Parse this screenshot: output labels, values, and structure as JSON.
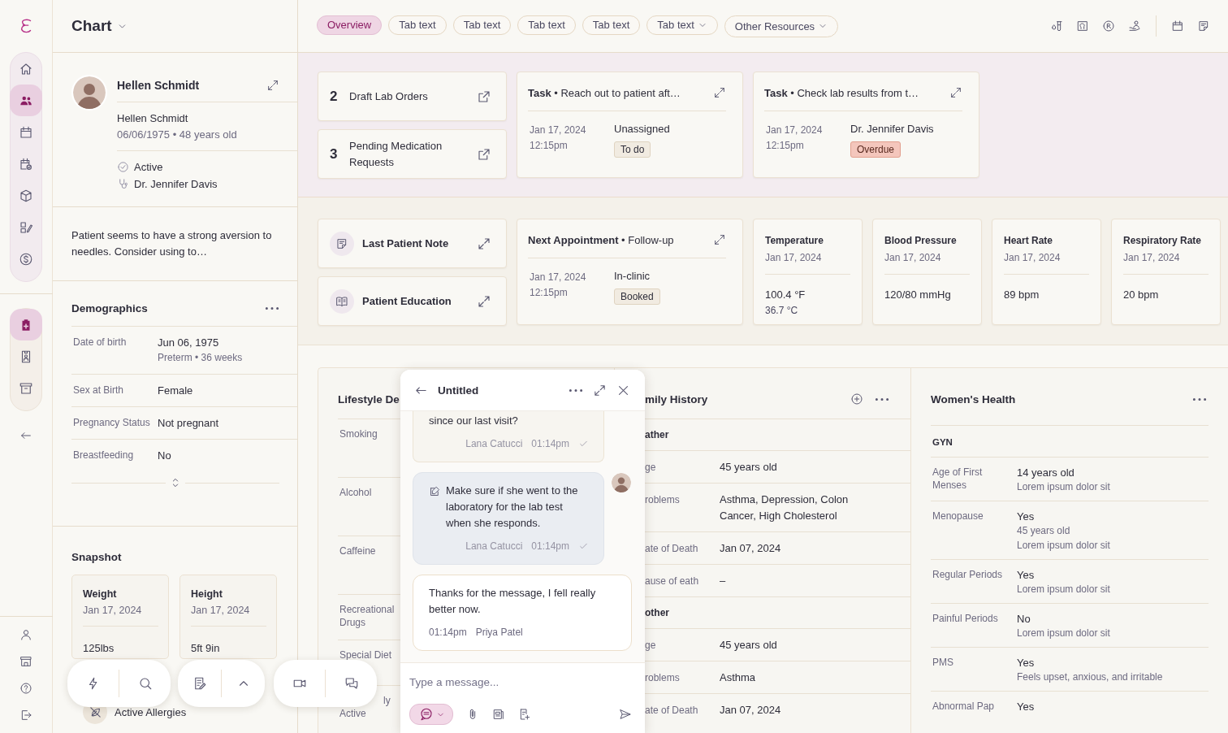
{
  "rail": {
    "groups": [
      [
        {
          "selected": false
        },
        {
          "selected": true
        },
        {
          "selected": false
        },
        {
          "selected": false
        },
        {
          "selected": false
        },
        {
          "selected": false
        },
        {
          "selected": false
        }
      ],
      [
        {
          "selected": true
        },
        {
          "selected": false
        },
        {
          "selected": false
        }
      ]
    ]
  },
  "sidebar": {
    "title": "Chart",
    "patient": {
      "name": "Hellen Schmidt",
      "full_name": "Hellen Schmidt",
      "birth_line": "06/06/1975 • 48 years old",
      "status": "Active",
      "provider": "Dr. Jennifer Davis"
    },
    "note": "Patient seems to have a strong aversion to needles. Consider using to…",
    "demographics": {
      "title": "Demographics",
      "rows": [
        {
          "label": "Date of birth",
          "value": "Jun 06, 1975",
          "detail": "Preterm • 36 weeks"
        },
        {
          "label": "Sex at Birth",
          "value": "Female"
        },
        {
          "label": "Pregnancy Status",
          "value": "Not pregnant"
        },
        {
          "label": "Breastfeeding",
          "value": "No"
        }
      ]
    },
    "snapshot": {
      "title": "Snapshot",
      "cards": [
        {
          "name": "Weight",
          "date": "Jan 17, 2024",
          "value": "125lbs"
        },
        {
          "name": "Height",
          "date": "Jan 17, 2024",
          "value": "5ft 9in"
        }
      ],
      "allergies": "Active Allergies"
    }
  },
  "tabs": [
    {
      "label": "Overview",
      "selected": true,
      "dropdown": false
    },
    {
      "label": "Tab text",
      "selected": false,
      "dropdown": false
    },
    {
      "label": "Tab text",
      "selected": false,
      "dropdown": false
    },
    {
      "label": "Tab text",
      "selected": false,
      "dropdown": false
    },
    {
      "label": "Tab text",
      "selected": false,
      "dropdown": false
    },
    {
      "label": "Tab text",
      "selected": false,
      "dropdown": true
    },
    {
      "label": "Other Resources",
      "selected": false,
      "dropdown": true
    }
  ],
  "summary": {
    "counts": [
      {
        "count": "2",
        "label": "Draft Lab Orders"
      },
      {
        "count": "3",
        "label": "Pending Medication Requests"
      }
    ],
    "tasks": [
      {
        "title": "**Task** • Reach out to patient aft…",
        "date": "Jan 17, 2024",
        "time": "12:15pm",
        "assignee": "Unassigned",
        "status": {
          "label": "To do",
          "kind": "neutral"
        }
      },
      {
        "title": "**Task** • Check lab results from t…",
        "date": "Jan 17, 2024",
        "time": "12:15pm",
        "assignee": "Dr. Jennifer Davis",
        "status": {
          "label": "Overdue",
          "kind": "alert"
        }
      }
    ]
  },
  "overview": {
    "links": [
      {
        "label": "Last Patient Note",
        "kind": "note"
      },
      {
        "label": "Patient Education",
        "kind": "book"
      }
    ],
    "appointment": {
      "title": "**Next Appointment** • Follow-up",
      "date": "Jan 17, 2024",
      "time": "12:15pm",
      "location": "In-clinic",
      "status": {
        "label": "Booked",
        "kind": "neutral"
      }
    },
    "vitals": [
      {
        "name": "Temperature",
        "date": "Jan 17, 2024",
        "value": "100.4 °F",
        "secondary": "36.7 °C"
      },
      {
        "name": "Blood Pressure",
        "date": "Jan 17, 2024",
        "value": "120/80 mmHg"
      },
      {
        "name": "Heart Rate",
        "date": "Jan 17, 2024",
        "value": "89 bpm"
      },
      {
        "name": "Respiratory Rate",
        "date": "Jan 17, 2024",
        "value": "20 bpm"
      }
    ]
  },
  "lifestyle": {
    "title": "Lifestyle De",
    "rows": [
      {
        "label": "Smoking"
      },
      {
        "label": "Alcohol"
      },
      {
        "label": "Caffeine"
      },
      {
        "label": "Recreational Drugs"
      },
      {
        "label": "Special Diet"
      },
      {
        "label": "ly Active"
      }
    ]
  },
  "family_history": {
    "title": "mily History",
    "sections": [
      {
        "heading": "ather",
        "rows": [
          {
            "label": "ge",
            "value": "45 years old"
          },
          {
            "label": "roblems",
            "value": "Asthma, Depression, Colon Cancer, High Cholesterol"
          },
          {
            "label": "ate of Death",
            "value": "Jan 07, 2024"
          },
          {
            "label": "ause of eath",
            "value": "–"
          }
        ]
      },
      {
        "heading": "other",
        "rows": [
          {
            "label": "ge",
            "value": "45 years old"
          },
          {
            "label": "roblems",
            "value": "Asthma"
          },
          {
            "label": "ate of Death",
            "value": "Jan 07, 2024"
          }
        ]
      }
    ]
  },
  "womens_health": {
    "title": "Women's Health",
    "section": "GYN",
    "rows": [
      {
        "label": "Age of First Menses",
        "value": "14 years old",
        "details": [
          "Lorem ipsum dolor sit"
        ]
      },
      {
        "label": "Menopause",
        "value": "Yes",
        "details": [
          "45 years old",
          "Lorem ipsum dolor sit"
        ]
      },
      {
        "label": "Regular Periods",
        "value": "Yes",
        "details": [
          "Lorem ipsum dolor sit"
        ]
      },
      {
        "label": "Painful Periods",
        "value": "No",
        "details": [
          "Lorem ipsum dolor sit"
        ]
      },
      {
        "label": "PMS",
        "value": "Yes",
        "details": [
          "Feels upset, anxious, and irritable"
        ]
      },
      {
        "label": "Abnormal Pap",
        "value": "Yes",
        "details": []
      }
    ]
  },
  "chat": {
    "title": "Untitled",
    "messages": [
      {
        "kind": "sent",
        "text": "since our last visit?",
        "author": "Lana Catucci",
        "time": "01:14pm"
      },
      {
        "kind": "note",
        "text": "Make sure if she went to the laboratory for the lab test when she responds.",
        "author": "Lana Catucci",
        "time": "01:14pm"
      },
      {
        "kind": "received",
        "text": "Thanks for the message, I fell really better now.",
        "author": "Priya Patel",
        "time": "01:14pm"
      }
    ],
    "placeholder": "Type a message..."
  }
}
